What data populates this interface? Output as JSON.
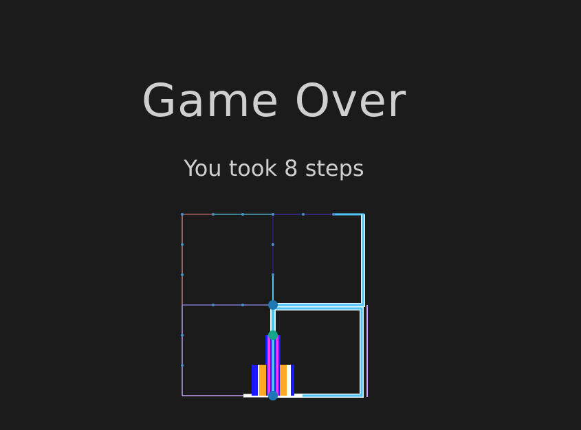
{
  "game_over": {
    "title": "Game Over",
    "message": "You took 8 steps"
  },
  "colors": {
    "background": "#1b1b1b",
    "text": "#cfcfcf",
    "path_cyan": "#4fc3f7",
    "path_blue": "#1a1aff",
    "path_magenta": "#ff33ff",
    "path_orange": "#ffa726",
    "node_teal_blue": "#1f77b4",
    "node_teal_green": "#17a589"
  }
}
